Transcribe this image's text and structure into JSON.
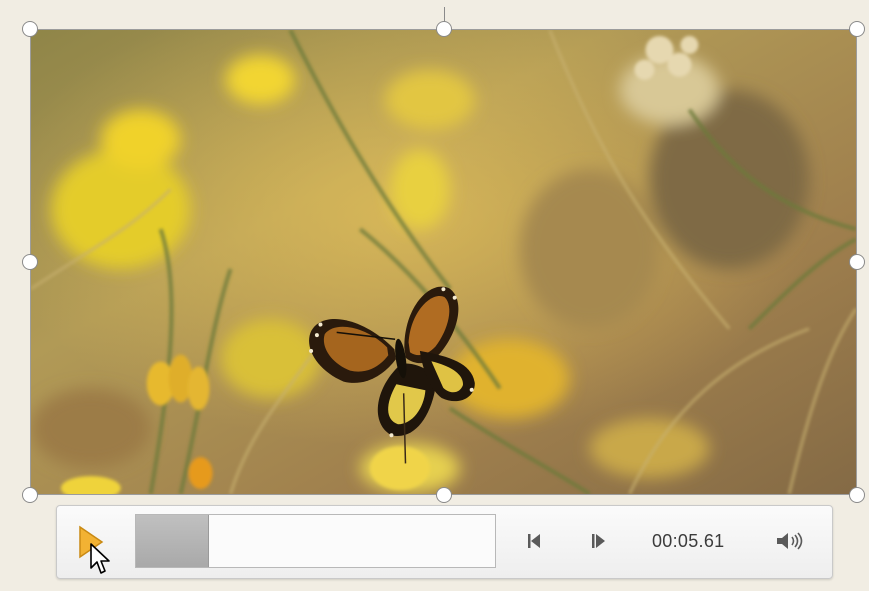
{
  "media_player": {
    "current_time": "00:05.61",
    "progress_fraction": 0.2,
    "play_icon": "play-triangle-icon",
    "skip_back_icon": "step-back-icon",
    "skip_forward_icon": "step-forward-icon",
    "volume_icon": "speaker-volume-icon"
  },
  "video": {
    "subject": "butterfly-on-yellow-flowers"
  },
  "colors": {
    "play_accent": "#f2b233",
    "handle_border": "#8a8a8a"
  }
}
